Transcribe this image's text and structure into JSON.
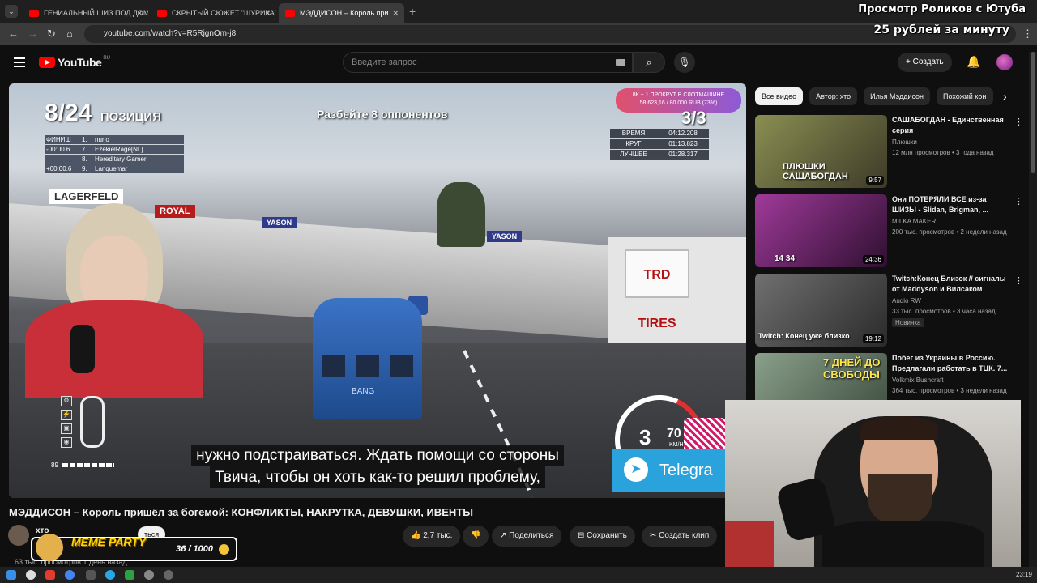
{
  "browser": {
    "tabs": [
      {
        "title": "ГЕНИАЛЬНЫЙ ШИЗ ПОД ДОМ..."
      },
      {
        "title": "СКРЫТЫЙ СЮЖЕТ \"ШУРИКА\""
      },
      {
        "title": "МЭДДИСОН – Король при..."
      }
    ],
    "url": "youtube.com/watch?v=R5RjgnOm-j8",
    "stream_overlay_line1": "Просмотр Роликов с Ютуба",
    "stream_overlay_line2": "25 рублей за минуту"
  },
  "youtube": {
    "logo_text": "YouTube",
    "region": "RU",
    "search_placeholder": "Введите запрос",
    "create_label": "Создать"
  },
  "video": {
    "title": "МЭДДИСОН – Король пришёл за богемой: КОНФЛИКТЫ, НАКРУТКА, ДЕВУШКИ, ИВЕНТЫ",
    "subtitle_line1": "нужно подстраиваться. Ждать помощи со стороны",
    "subtitle_line2": "Твича, чтобы он хоть как-то решил проблему,",
    "channel_name": "хто",
    "subscribe_label": "ться",
    "likes": "2,7 тыс.",
    "share_label": "Поделиться",
    "save_label": "Сохранить",
    "clip_label": "Создать клип",
    "views_text": "63 тыс. просмотров  1 день назад"
  },
  "game_hud": {
    "position": "8/24",
    "position_label": "ПОЗИЦИЯ",
    "mission": "Разбейте 8 оппонентов",
    "laps": "3/3",
    "alert_text": "8К + 1 ПРОКРУТ В СЛОТМАШИНЕ",
    "alert_progress": "58 623,16 / 80 000 RUB (73%)",
    "standings": [
      {
        "gap": "ФИНИШ",
        "place": "1.",
        "name": "nurjo"
      },
      {
        "gap": "-00:00.6",
        "place": "7.",
        "name": "EzekielRage[NL]"
      },
      {
        "gap": "",
        "place": "8.",
        "name": "Hereditary Gamer"
      },
      {
        "gap": "+00:00.6",
        "place": "9.",
        "name": "Lanquemar"
      }
    ],
    "timing": [
      {
        "key": "ВРЕМЯ",
        "value": "04:12.208"
      },
      {
        "key": "КРУГ",
        "value": "01:13.823"
      },
      {
        "key": "ЛУЧШЕЕ",
        "value": "01:28.317"
      }
    ],
    "fuel": "89",
    "gear": "3",
    "speed": "70",
    "speed_unit": "KM/H",
    "telegram_label": "Telegra"
  },
  "meme_widget": {
    "name": "MEME PARTY",
    "count": "36 / 1000"
  },
  "chips": [
    "Все видео",
    "Автор: хто",
    "Илья Мэддисон",
    "Похожий кон"
  ],
  "recommendations": [
    {
      "title": "САШАБОГДАН - Единственная серия",
      "channel": "Плюшки",
      "meta": "12 млн просмотров • 3 года назад",
      "duration": "9:57",
      "thumb_text": "ПЛЮШКИ САШАБОГДАН",
      "color": "#6a6f3a"
    },
    {
      "title": "Они ПОТЕРЯЛИ ВСЕ из-за ШИЗЫ - Slidan, Brigman, ...",
      "channel": "MILKA MAKER",
      "meta": "200 тыс. просмотров • 2 недели назад",
      "duration": "24:36",
      "thumb_text": "14 34",
      "color": "#6a2a7a"
    },
    {
      "title": "Twitch:Конец Близок // сигналы от Maddyson и Вилсаком",
      "channel": "Audio RW",
      "meta": "33 тыс. просмотров • 3 часа назад",
      "duration": "19:12",
      "thumb_text": "Twitch: Конец уже близко",
      "badge": "Новинка",
      "color": "#4a4a4a"
    },
    {
      "title": "Побег из Украины в Россию. Предлагали работать в ТЦК. 7...",
      "channel": "Volkmix Bushcraft",
      "meta": "364 тыс. просмотров • 3 недели назад",
      "duration": "",
      "thumb_text": "7 ДНЕЙ ДО СВОБОДЫ",
      "color": "#5d7560"
    }
  ],
  "taskbar": {
    "clock": "23:19"
  }
}
